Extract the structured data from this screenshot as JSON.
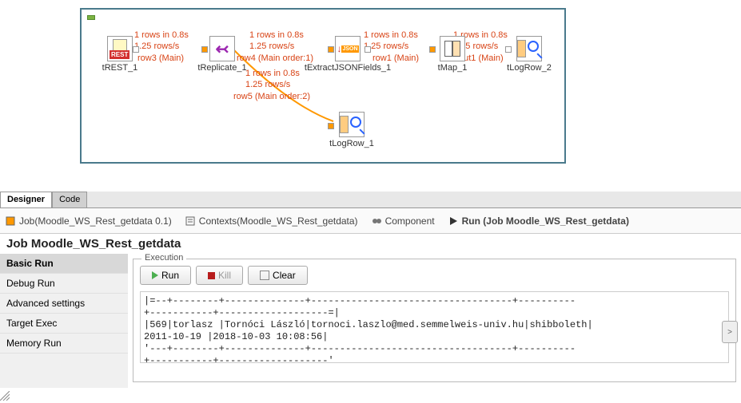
{
  "canvas": {
    "nodes": {
      "trest": {
        "label": "tREST_1"
      },
      "treplicate": {
        "label": "tReplicate_1"
      },
      "textractjson": {
        "label": "tExtractJSONFields_1"
      },
      "tmap": {
        "label": "tMap_1"
      },
      "tlogrow2": {
        "label": "tLogRow_2"
      },
      "tlogrow1": {
        "label": "tLogRow_1"
      }
    },
    "stats": {
      "s1": "1 rows in 0.8s",
      "r1": "1.25 rows/s",
      "s2": "1 rows in 0.8s",
      "r2": "1.25 rows/s",
      "s3": "1 rows in 0.8s",
      "r3": "1.25 rows/s",
      "s4": "1 rows in 0.8s",
      "r4": "1.25 rows/s",
      "s5": "1 rows in 0.8s",
      "r5": "1.25 rows/s"
    },
    "flows": {
      "row3": "row3 (Main)",
      "row4": "row4 (Main order:1)",
      "row1": "row1 (Main)",
      "out1": "out1 (Main)",
      "row5": "row5 (Main order:2)"
    }
  },
  "designer_tabs": {
    "designer": "Designer",
    "code": "Code"
  },
  "view_tabs": {
    "job": "Job(Moodle_WS_Rest_getdata 0.1)",
    "contexts": "Contexts(Moodle_WS_Rest_getdata)",
    "component": "Component",
    "run": "Run (Job Moodle_WS_Rest_getdata)"
  },
  "job_title": "Job Moodle_WS_Rest_getdata",
  "sidebar": {
    "items": [
      "Basic Run",
      "Debug Run",
      "Advanced settings",
      "Target Exec",
      "Memory Run"
    ]
  },
  "execution": {
    "legend": "Execution",
    "run_btn": "Run",
    "kill_btn": "Kill",
    "clear_btn": "Clear",
    "scroll_btn": ">",
    "console": "|=--+--------+--------------+-----------------------------------+----------\n+-----------+-------------------=|\n|569|torlasz |Tornóci László|tornoci.laszlo@med.semmelweis-univ.hu|shibboleth|\n2011-10-19 |2018-10-03 10:08:56|\n'---+--------+--------------+-----------------------------------+----------\n+-----------+-------------------'"
  }
}
